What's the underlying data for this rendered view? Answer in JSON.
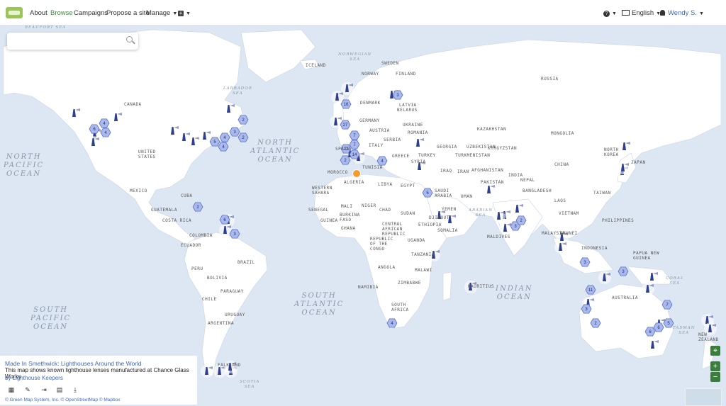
{
  "nav": {
    "about": "About",
    "browse": "Browse",
    "campaigns": "Campaigns",
    "propose": "Propose a site",
    "manage": "Manage",
    "help": "?",
    "language": "English",
    "user": "Wendy S."
  },
  "search": {
    "placeholder": ""
  },
  "info": {
    "title": "Made In Smethwick: Lighthouses Around the World",
    "description": "This map shows known lighthouse lenses manufactured at Chance Glass Works",
    "byline": "by Lighthouse Keepers",
    "attribution": "© Green Map System, Inc. © OpenStreetMap © Mapbox",
    "icons": [
      "grid-icon",
      "pencil-icon",
      "share-icon",
      "table-icon",
      "download-icon"
    ]
  },
  "oceans": [
    {
      "text": "NORTH\nPACIFIC\nOCEAN"
    },
    {
      "text": "NORTH\nATLANTIC\nOCEAN"
    },
    {
      "text": "SOUTH\nATLANTIC\nOCEAN"
    },
    {
      "text": "SOUTH\nPACIFIC\nOCEAN"
    },
    {
      "text": "INDIAN\nOCEAN"
    }
  ],
  "seas": [
    "BEAUFORT SEA",
    "LABRADOR\nSEA",
    "NORWEGIAN\nSEA",
    "CORAL\nSEA",
    "TASMAN\nSEA",
    "ARABIAN\nSEA",
    "SCOTIA\nSEA"
  ],
  "places": [
    "CANADA",
    "UNITED\nSTATES",
    "MEXICO",
    "CUBA",
    "GUATEMALA",
    "COSTA RICA",
    "COLOMBIA",
    "ECUADOR",
    "PERU",
    "BRAZIL",
    "BOLIVIA",
    "PARAGUAY",
    "CHILE",
    "URUGUAY",
    "ARGENTINA",
    "FALKLAND",
    "ICELAND",
    "NORWAY",
    "SWEDEN",
    "FINLAND",
    "DENMARK",
    "LATVIA",
    "BELARUS",
    "GERMANY",
    "AUSTRIA",
    "UKRAINE",
    "ROMANIA",
    "SERBIA",
    "ITALY",
    "SPAIN",
    "GREECE",
    "TURKEY",
    "GEORGIA",
    "TUNISIA",
    "MOROCCO",
    "ALGERIA",
    "LIBYA",
    "EGYPT",
    "WESTERN\nSAHARA",
    "MALI",
    "NIGER",
    "CHAD",
    "SUDAN",
    "SENEGAL",
    "GUINEA",
    "BURKINA\nFASO",
    "GHANA",
    "CENTRAL\nAFRICAN\nREPUBLIC",
    "ETHIOPIA",
    "SOMALIA",
    "DJIBOUTI",
    "YEMEN",
    "OMAN",
    "SAUDI\nARABIA",
    "SYRIA",
    "IRAN",
    "IRAQ",
    "AFGHANISTAN",
    "PAKISTAN",
    "TURKMENISTAN",
    "UZBEKISTAN",
    "KAZAKHSTAN",
    "KYRGYZSTAN",
    "RUSSIA",
    "MONGOLIA",
    "CHINA",
    "INDIA",
    "NEPAL",
    "BANGLADESH",
    "LAOS",
    "VIETNAM",
    "PHILIPPINES",
    "TAIWAN",
    "JAPAN",
    "NORTH\nKOREA",
    "MALAYSIA",
    "BRUNEI",
    "INDONESIA",
    "PAPUA NEW\nGUINEA",
    "MALDIVES",
    "AUSTRALIA",
    "NEW\nZEALAND",
    "REPUBLIC\nOF THE\nCONGO",
    "UGANDA",
    "TANZANIA",
    "ANGOLA",
    "MALAWI",
    "ZIMBABWE",
    "NAMIBIA",
    "SOUTH\nAFRICA",
    "MAURITIUS"
  ],
  "clusters": [
    "6",
    "4",
    "27",
    "16",
    "22",
    "14",
    "7",
    "2",
    "7",
    "5",
    "2",
    "3",
    "4",
    "4",
    "4",
    "3",
    "2",
    "4",
    "5",
    "6",
    "2",
    "3",
    "3",
    "2",
    "3",
    "3",
    "11",
    "3",
    "7",
    "5",
    "6",
    "6",
    "2",
    "4"
  ],
  "colors": {
    "water": "#dde7f3",
    "land": "#ffffff",
    "cluster": "#a9b9ee",
    "cluster_border": "#5b6fc4",
    "accent": "#3f8c40",
    "link": "#3d67c4"
  }
}
